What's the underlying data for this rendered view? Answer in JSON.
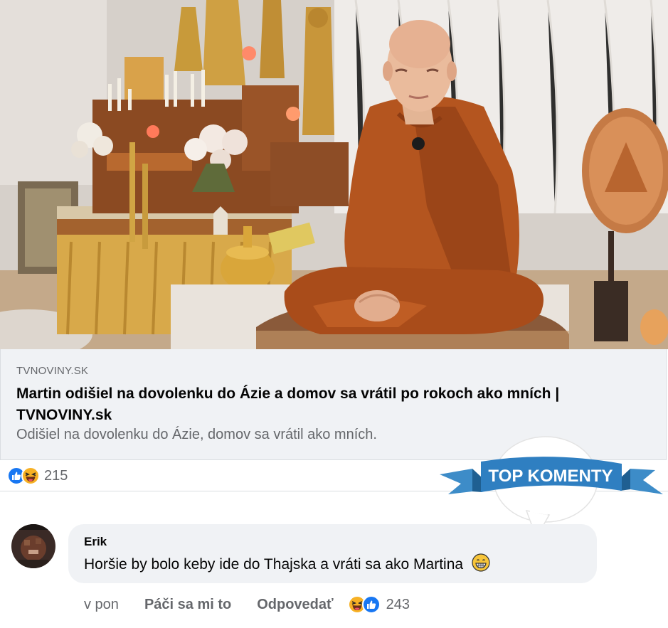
{
  "post": {
    "link_preview": {
      "domain": "TVNOVINY.SK",
      "title": "Martin odišiel na dovolenku do Ázie a domov sa vrátil po rokoch ako mních | TVNOVINY.sk",
      "description": "Odišiel na dovolenku do Ázie, domov sa vrátil ako mních."
    },
    "reactions": {
      "icons": [
        "like-icon",
        "haha-icon"
      ],
      "count": "215"
    }
  },
  "badge": {
    "label": "TOP KOMENTY"
  },
  "comment": {
    "author": "Erik",
    "text": "Horšie by bolo keby ide do Thajska a vráti sa ako Martina",
    "emoji": "grinning-face-icon",
    "time": "v pon",
    "like_label": "Páči sa mi to",
    "reply_label": "Odpovedať",
    "reactions": {
      "icons": [
        "haha-icon",
        "like-icon"
      ],
      "count": "243"
    }
  },
  "colors": {
    "facebook_blue": "#1877f2",
    "reaction_yellow": "#f7b125",
    "robe_orange": "#b4551f",
    "badge_blue": "#2f7fc1",
    "card_background": "#f0f2f5",
    "secondary_text": "#65676b"
  }
}
